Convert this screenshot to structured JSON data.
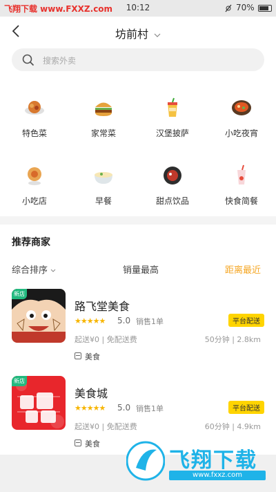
{
  "statusbar": {
    "watermark": "飞翔下载 www.FXXZ.com",
    "time": "10:12",
    "battery": "70%"
  },
  "header": {
    "title": "坊前村"
  },
  "search": {
    "placeholder": "搜索外卖"
  },
  "categories": [
    {
      "label": "特色菜",
      "icon": "specialty-dish-icon"
    },
    {
      "label": "家常菜",
      "icon": "burger-icon"
    },
    {
      "label": "汉堡披萨",
      "icon": "drink-cup-icon"
    },
    {
      "label": "小吃夜宵",
      "icon": "hotpot-icon"
    },
    {
      "label": "小吃店",
      "icon": "snack-icon"
    },
    {
      "label": "早餐",
      "icon": "noodle-bowl-icon"
    },
    {
      "label": "甜点饮品",
      "icon": "dessert-icon"
    },
    {
      "label": "快食简餐",
      "icon": "fast-food-icon"
    }
  ],
  "section": {
    "title": "推荐商家"
  },
  "sort": {
    "default": "综合排序",
    "sales": "销量最高",
    "distance": "距离最近",
    "active_color": "#f5a623"
  },
  "shops": [
    {
      "new_tag": "新店",
      "name": "路飞堂美食",
      "stars": "★★★★★",
      "rating": "5.0",
      "sales": "销售1单",
      "badge": "平台配送",
      "delivery": "起送¥0 | 免配送费",
      "distance": "50分钟 | 2.8km",
      "category": "美食"
    },
    {
      "new_tag": "新店",
      "name": "美食城",
      "stars": "★★★★★",
      "rating": "5.0",
      "sales": "销售1单",
      "badge": "平台配送",
      "delivery": "起送¥0 | 免配送费",
      "distance": "60分钟 | 4.9km",
      "category": "美食"
    }
  ],
  "watermark_bottom": {
    "text": "飞翔下载",
    "url": "www.fxxz.com"
  }
}
